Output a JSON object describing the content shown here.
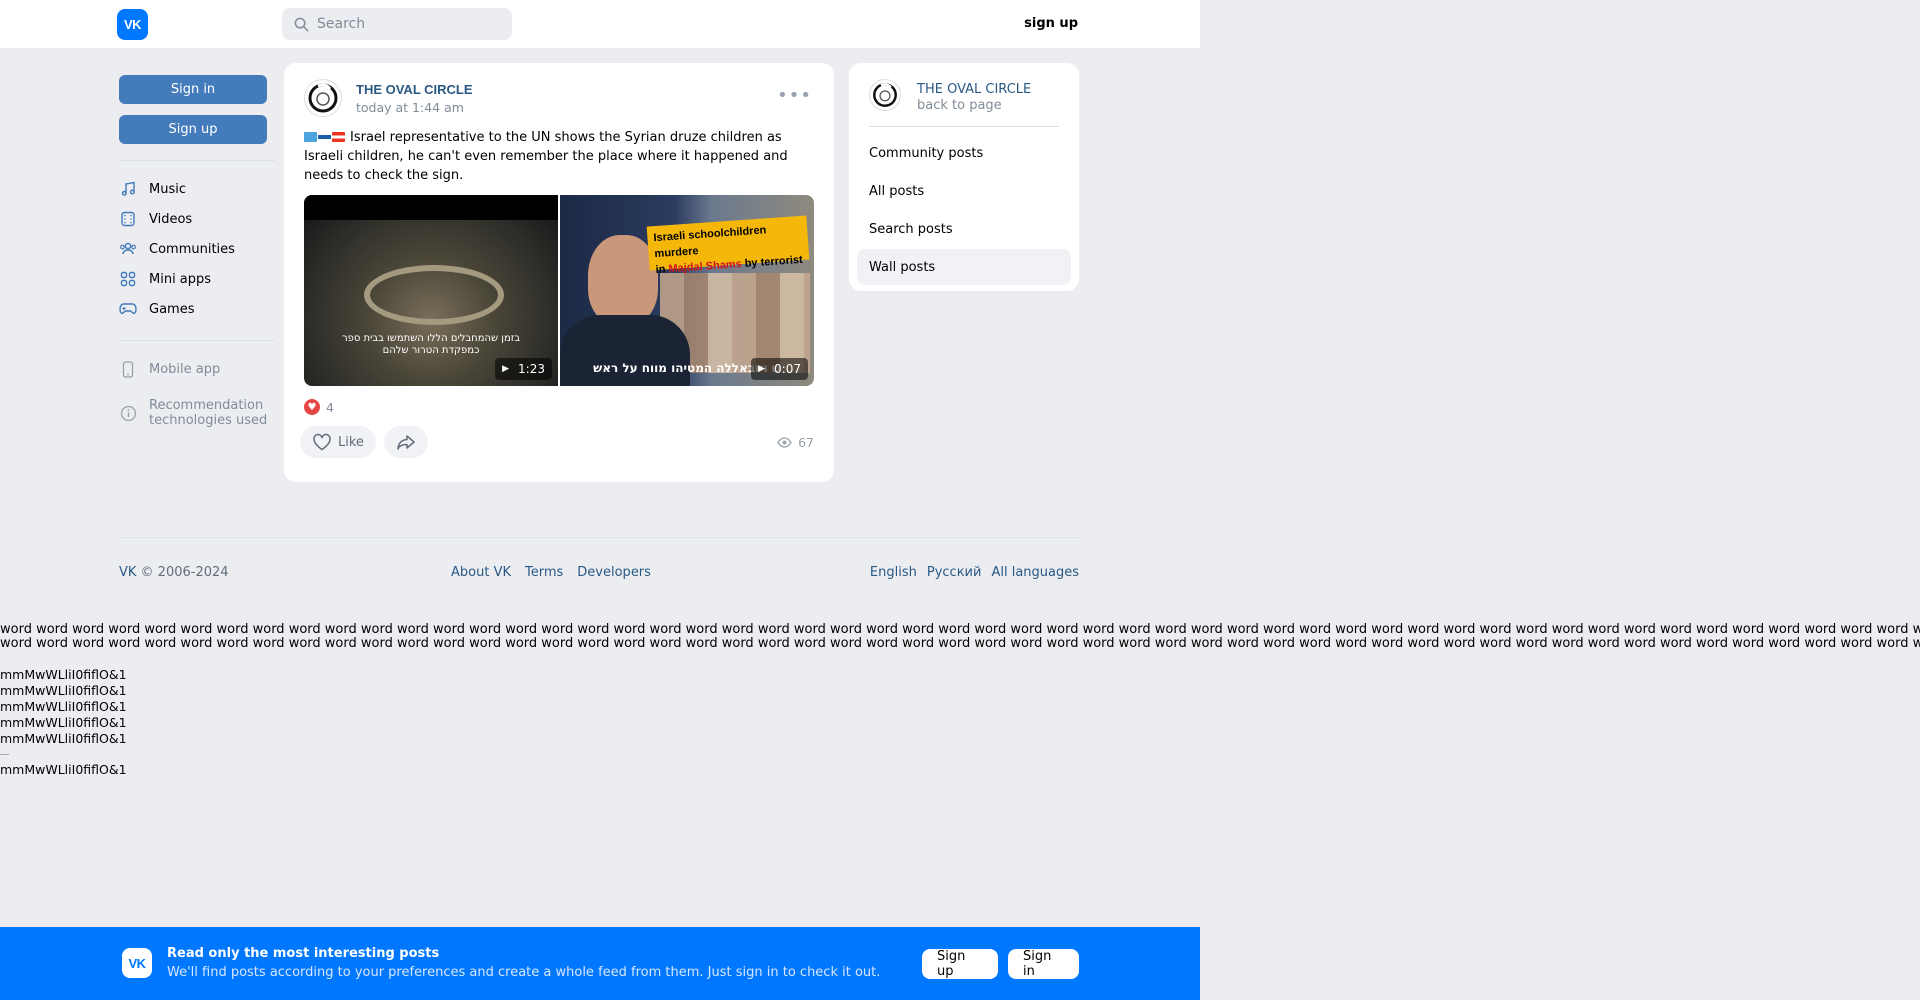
{
  "header": {
    "logo": "VK",
    "search_placeholder": "Search",
    "signup": "sign up"
  },
  "sidebar": {
    "sign_in": "Sign in",
    "sign_up": "Sign up",
    "nav": [
      {
        "label": "Music",
        "icon": "music-icon"
      },
      {
        "label": "Videos",
        "icon": "video-icon"
      },
      {
        "label": "Communities",
        "icon": "communities-icon"
      },
      {
        "label": "Mini apps",
        "icon": "mini-apps-icon"
      },
      {
        "label": "Games",
        "icon": "gamepad-icon"
      }
    ],
    "mobile_app": "Mobile app",
    "recommendation_line1": "Recommendation",
    "recommendation_line2": "technologies used"
  },
  "post": {
    "author": "THE OVAL CIRCLE",
    "time": "today at 1:44 am",
    "text": "Israel representative to the UN shows the Syrian druze children as Israeli children, he can't even remember the place where it happened and needs to check the sign.",
    "video1": {
      "duration": "1:23",
      "subtitle_line1": "בזמן שהמחבלים הללו השתמשו בבית ספר",
      "subtitle_line2": "כמפקדת הטרור שלהם"
    },
    "video2": {
      "duration": "0:07",
      "banner_line1": "Israeli schoolchildren murdere",
      "banner_in": "in ",
      "banner_place": "Majdal Shams",
      "banner_rest": " by terrorist",
      "subtitle": "ש ויזבאללה המטיהו מווח על ראש"
    },
    "reactions_count": "4",
    "like_label": "Like",
    "views": "67"
  },
  "right_panel": {
    "name": "THE OVAL CIRCLE",
    "back": "back to page",
    "menu": [
      "Community posts",
      "All posts",
      "Search posts",
      "Wall posts"
    ]
  },
  "footer": {
    "copyright_vk": "VK",
    "copyright_years": " © 2006-2024",
    "links": [
      "About VK",
      "Terms",
      "Developers"
    ],
    "languages": [
      "English",
      "Русский",
      "All languages"
    ]
  },
  "filler": {
    "word_line": "word word word word word word word word word word word word word word word word word word word word word word word word word word word word word word word word word word word word word word word word word word word word word word word word word word word word word word word word word word word word word word word word word word word word word word word word word word word word word word word word word word",
    "m_line": "mmMwWLliI0fiflO&1"
  },
  "bottom_banner": {
    "title": "Read only the most interesting posts",
    "subtitle": "We'll find posts according to your preferences and create a whole feed from them. Just sign in to check it out.",
    "sign_up": "Sign up",
    "sign_in": "Sign in"
  }
}
